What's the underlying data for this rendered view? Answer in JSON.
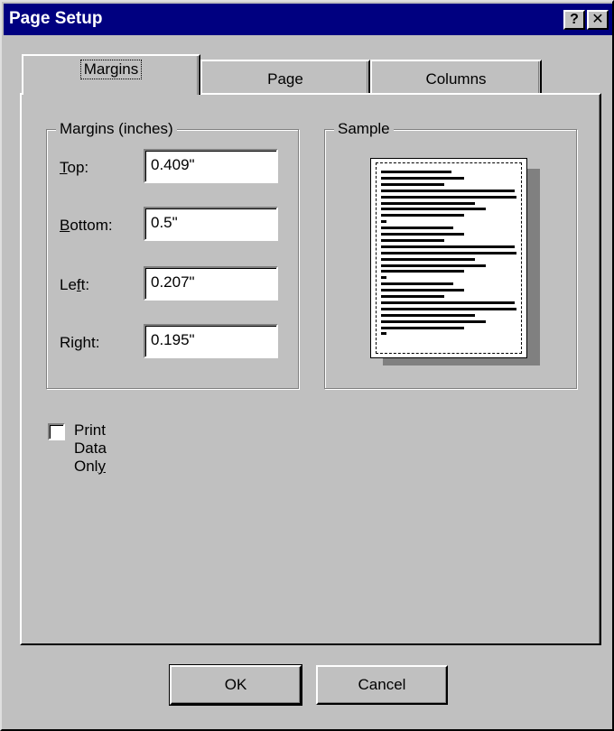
{
  "window": {
    "title": "Page Setup",
    "help_glyph": "?",
    "close_glyph": "✕"
  },
  "tabs": [
    {
      "label": "Margins",
      "selected": true
    },
    {
      "label": "Page",
      "selected": false
    },
    {
      "label": "Columns",
      "selected": false
    }
  ],
  "margins_group": {
    "legend": "Margins (inches)",
    "fields": [
      {
        "label_pre": "",
        "label_mnemonic": "T",
        "label_post": "op:",
        "value": "0.409\""
      },
      {
        "label_pre": "",
        "label_mnemonic": "B",
        "label_post": "ottom:",
        "value": "0.5\""
      },
      {
        "label_pre": "Le",
        "label_mnemonic": "f",
        "label_post": "t:",
        "value": "0.207\""
      },
      {
        "label_pre": "Ri",
        "label_mnemonic": "g",
        "label_post": "ht:",
        "value": "0.195\""
      }
    ]
  },
  "sample_group": {
    "legend": "Sample"
  },
  "print_data_only": {
    "label_pre": "Print Data Onl",
    "label_mnemonic": "y",
    "checked": false
  },
  "buttons": {
    "ok": "OK",
    "cancel": "Cancel"
  },
  "colors": {
    "titlebar": "#000080",
    "face": "#c0c0c0"
  }
}
